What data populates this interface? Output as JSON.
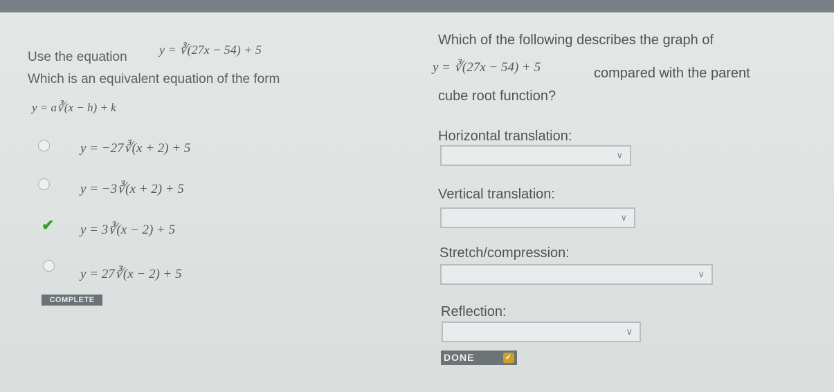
{
  "left": {
    "prompt_line1": "Use the equation",
    "equation": "y = ∛(27x − 54) + 5",
    "prompt_line2": "Which is an equivalent equation of the form",
    "form": "y = a∛(x − h) + k",
    "options": [
      {
        "text": "y = −27∛(x + 2) + 5",
        "state": "unselected"
      },
      {
        "text": "y = −3∛(x + 2) + 5",
        "state": "unselected"
      },
      {
        "text": "y = 3∛(x − 2) + 5",
        "state": "correct"
      },
      {
        "text": "y = 27∛(x − 2) + 5",
        "state": "unselected"
      }
    ],
    "complete_label": "COMPLETE"
  },
  "right": {
    "question_line1": "Which of the following describes the graph of",
    "equation": "y = ∛(27x − 54) + 5",
    "question_line2": "compared with the parent",
    "question_line3": "cube root function?",
    "dropdowns": [
      {
        "label": "Horizontal translation:",
        "value": ""
      },
      {
        "label": "Vertical translation:",
        "value": ""
      },
      {
        "label": "Stretch/compression:",
        "value": ""
      },
      {
        "label": "Reflection:",
        "value": ""
      }
    ],
    "done_label": "DONE"
  },
  "colors": {
    "check": "#3f9b33",
    "done_icon": "#c9a028",
    "topbar": "#7b8088"
  },
  "icons": {
    "check": "checkmark-icon",
    "chevron": "chevron-down-icon"
  }
}
